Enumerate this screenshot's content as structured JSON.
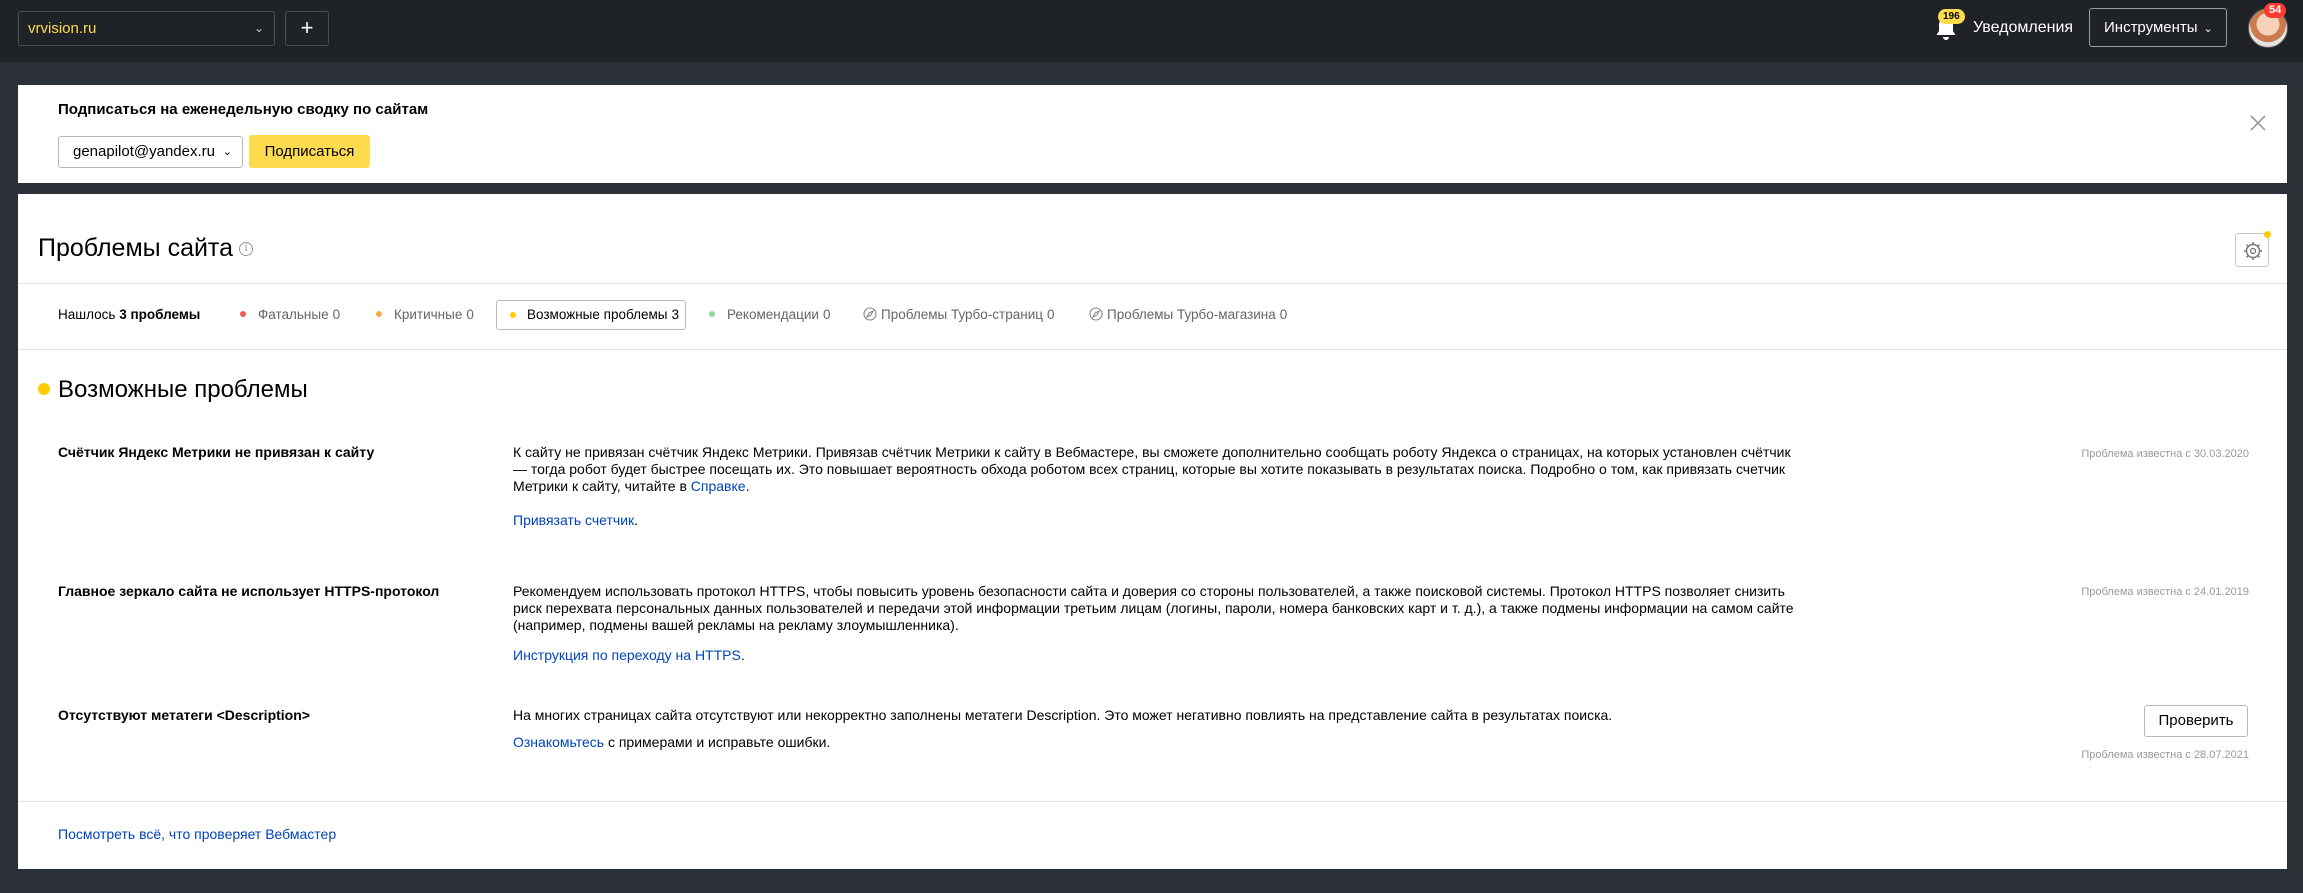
{
  "header": {
    "site": "vrvision.ru",
    "add_label": "+",
    "notifications_count": "196",
    "notifications_label": "Уведомления",
    "tools_label": "Инструменты",
    "avatar_badge": "54"
  },
  "subscribe": {
    "title": "Подписаться на еженедельную сводку по сайтам",
    "email": "genapilot@yandex.ru",
    "button": "Подписаться"
  },
  "page": {
    "title": "Проблемы сайта",
    "found_prefix": "Нашлось",
    "found_count": "3 проблемы",
    "filters": [
      {
        "label": "Фатальные",
        "count": "0",
        "color": "#f05a4b"
      },
      {
        "label": "Критичные",
        "count": "0",
        "color": "#f7a94a"
      },
      {
        "label": "Возможные проблемы",
        "count": "3",
        "color": "#ffcc00"
      },
      {
        "label": "Рекомендации",
        "count": "0",
        "color": "#8fd694"
      },
      {
        "label": "Проблемы Турбо-страниц",
        "count": "0",
        "icon": "rocket-icon"
      },
      {
        "label": "Проблемы Турбо-магазина",
        "count": "0",
        "icon": "rocket-icon"
      }
    ],
    "section_title": "Возможные проблемы",
    "issues": [
      {
        "title": "Счётчик Яндекс Метрики не привязан к сайту",
        "desc_line1": "К сайту не привязан счётчик Яндекс Метрики. Привязав счётчик Метрики к сайту в Вебмастере, вы сможете дополнительно сообщать роботу Яндекса о страницах, на которых установлен счётчик",
        "desc_line2": "— тогда робот будет быстрее посещать их. Это повышает вероятность обхода роботом всех страниц, которые вы хотите показывать в результатах поиска. Подробно о том, как привязать счетчик",
        "desc_line3_prefix": "Метрики к сайту, читайте в",
        "desc_link": "Справке",
        "action_link": "Привязать счетчик",
        "date": "Проблема известна с 30.03.2020"
      },
      {
        "title": "Главное зеркало сайта не использует HTTPS-протокол",
        "desc_line1": "Рекомендуем использовать протокол HTTPS, чтобы повысить уровень безопасности сайта и доверия со стороны пользователей, а также поисковой системы. Протокол HTTPS позволяет снизить",
        "desc_line2": "риск перехвата персональных данных пользователей и передачи этой информации третьим лицам (логины, пароли, номера банковских карт и т. д.), а также подмены информации на самом сайте",
        "desc_line3": "(например, подмены вашей рекламы на рекламу злоумышленника).",
        "action_link": "Инструкция по переходу на HTTPS",
        "date": "Проблема известна с 24.01.2019"
      },
      {
        "title": "Отсутствуют метатеги <Description>",
        "desc_line1": "На многих страницах сайта отсутствуют или некорректно заполнены метатеги Description. Это может негативно повлиять на представление сайта в результатах поиска.",
        "action_link": "Ознакомьтесь",
        "action_suffix": " с примерами и исправьте ошибки.",
        "button": "Проверить",
        "date": "Проблема известна с 28.07.2021"
      }
    ],
    "footer_link": "Посмотреть всё, что проверяет Вебмастер"
  }
}
